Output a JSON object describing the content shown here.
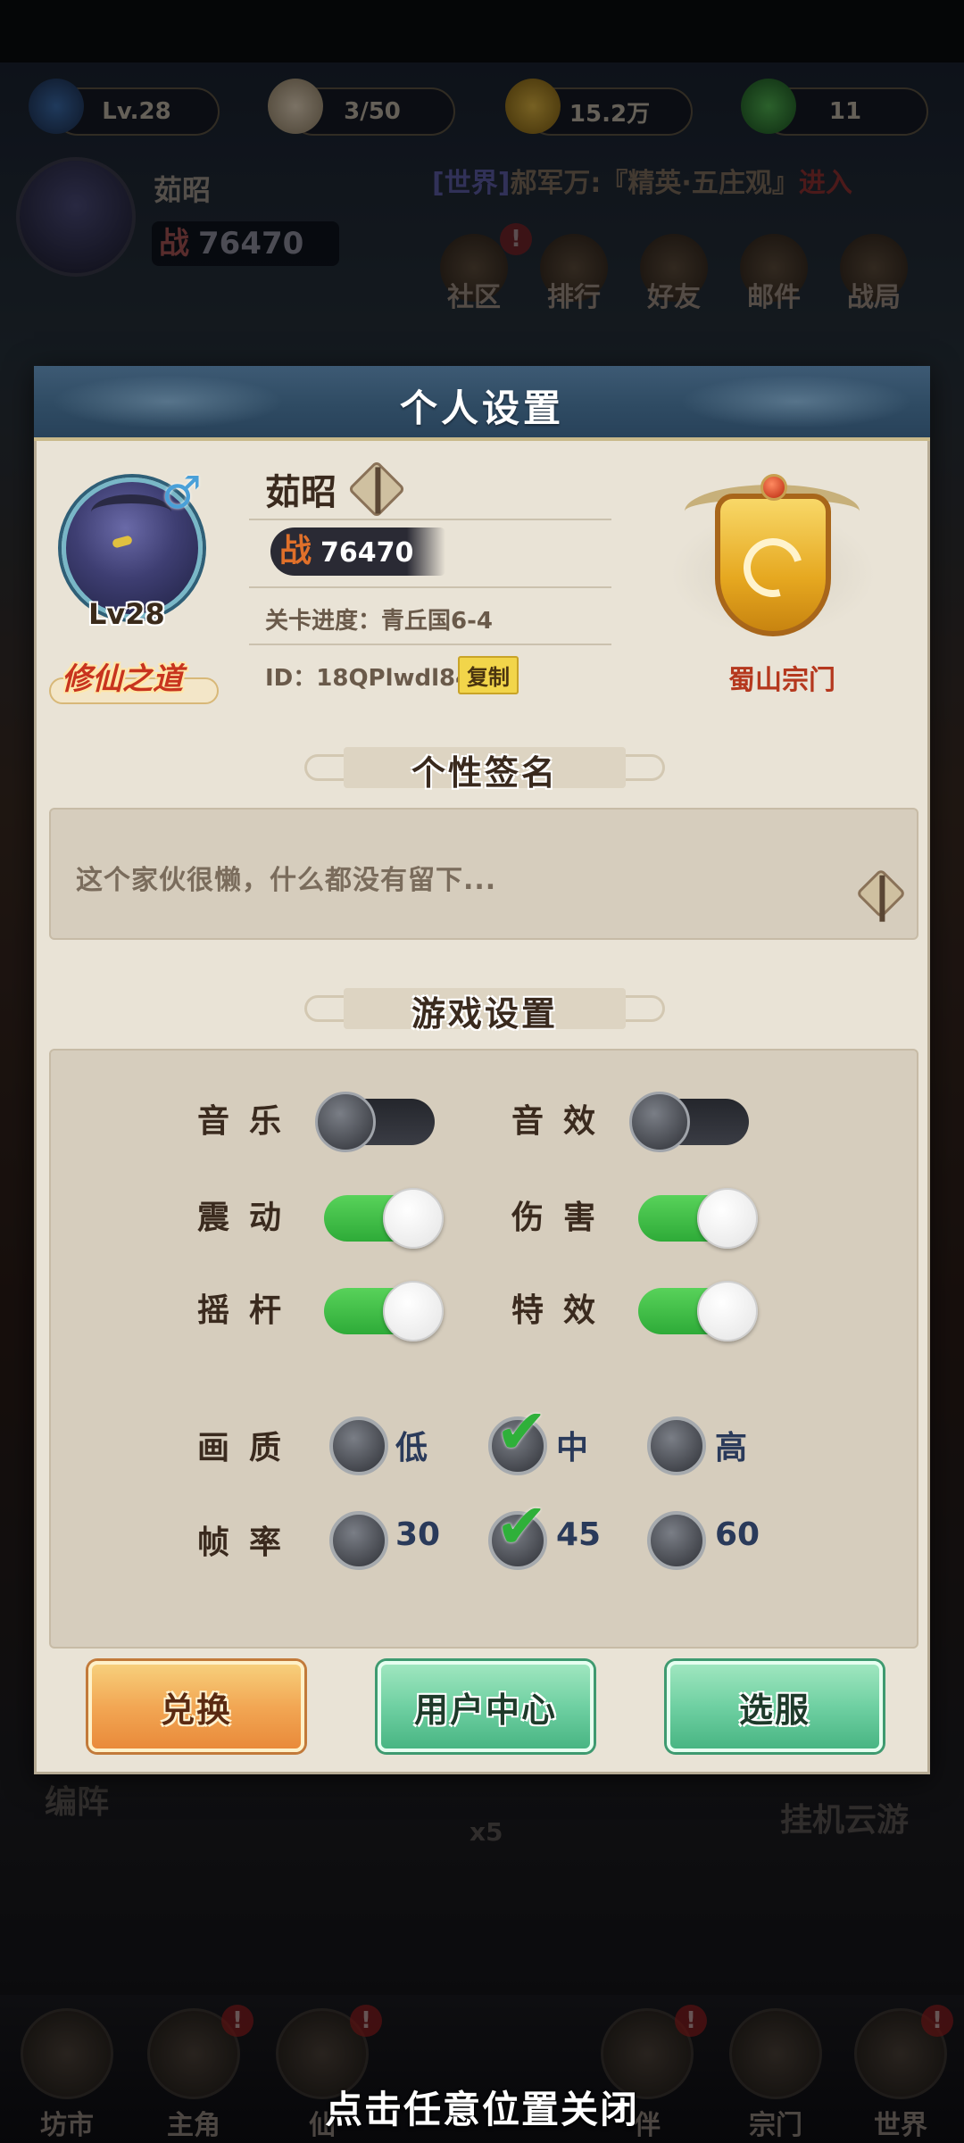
{
  "background": {
    "resources": [
      {
        "icon": "spiral-icon",
        "value": "Lv.28"
      },
      {
        "icon": "bun-icon",
        "value": "3/50"
      },
      {
        "icon": "coin-icon",
        "value": "15.2万"
      },
      {
        "icon": "leaf-icon",
        "value": "11"
      }
    ],
    "player_name": "茹昭",
    "power_label": "战",
    "power_value": "76470",
    "world_tag": "[世界]",
    "world_text": "郝军万:『精英·五庄观』",
    "world_enter": "进入",
    "top_menu": [
      "社区",
      "排行",
      "好友",
      "邮件",
      "战局"
    ],
    "bottom_menu": [
      "坊市",
      "主角",
      "仙",
      "伴",
      "宗门",
      "世界"
    ],
    "faded_labels": [
      "编阵",
      "挂机云游",
      "x5"
    ]
  },
  "panel": {
    "title": "个人设置",
    "player": {
      "name": "茹昭",
      "level": "Lv28",
      "power_label": "战",
      "power": "76470",
      "stage": "关卡进度：青丘国6-4",
      "id": "ID：18QPlwdl84",
      "copy_label": "复制",
      "badge": "修仙之道",
      "gender": "♂"
    },
    "sect": {
      "name": "蜀山宗门"
    },
    "signature": {
      "title": "个性签名",
      "text": "这个家伙很懒，什么都没有留下..."
    },
    "settings": {
      "title": "游戏设置",
      "toggles": [
        {
          "label": "音乐",
          "on": false
        },
        {
          "label": "音效",
          "on": false
        },
        {
          "label": "震动",
          "on": true
        },
        {
          "label": "伤害",
          "on": true
        },
        {
          "label": "摇杆",
          "on": true
        },
        {
          "label": "特效",
          "on": true
        }
      ],
      "quality": {
        "label": "画质",
        "options": [
          "低",
          "中",
          "高"
        ],
        "selected": "中"
      },
      "fps": {
        "label": "帧率",
        "options": [
          "30",
          "45",
          "60"
        ],
        "selected": "45"
      }
    },
    "buttons": {
      "redeem": "兑换",
      "user_center": "用户中心",
      "select_server": "选服"
    }
  },
  "close_hint": "点击任意位置关闭",
  "colors": {
    "toggle_on": "#2eab38",
    "toggle_off": "#24262c",
    "panel_bg": "#e9e3d6",
    "header_blue": "#2f4b63"
  }
}
